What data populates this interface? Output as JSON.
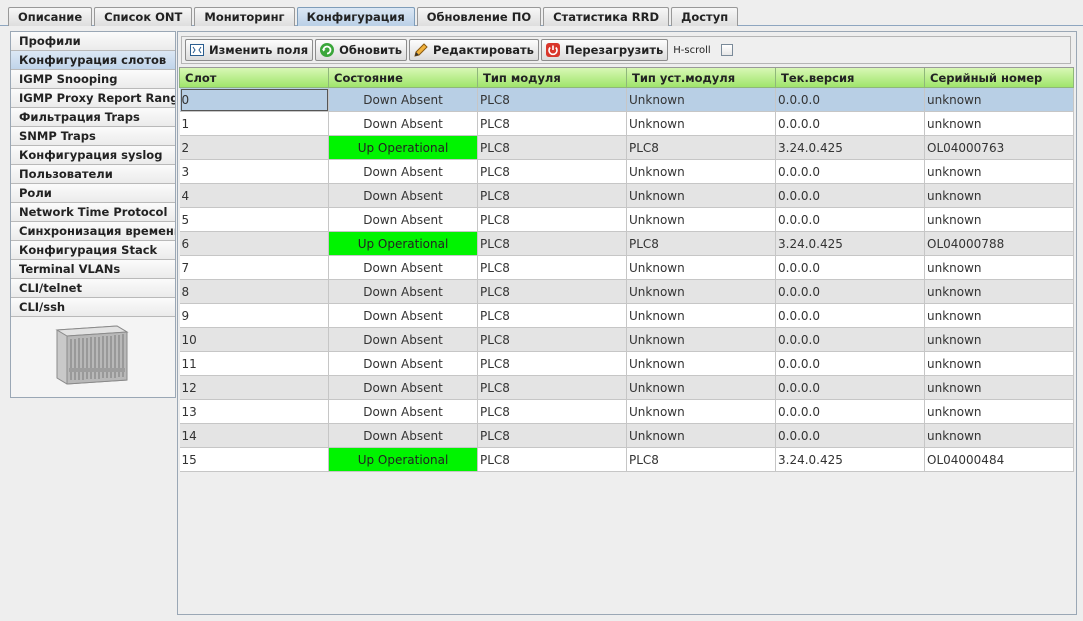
{
  "tabs": [
    {
      "label": "Описание"
    },
    {
      "label": "Список ONT"
    },
    {
      "label": "Мониторинг"
    },
    {
      "label": "Конфигурация",
      "active": true
    },
    {
      "label": "Обновление ПО"
    },
    {
      "label": "Статистика RRD"
    },
    {
      "label": "Доступ"
    }
  ],
  "sidebar": {
    "items": [
      {
        "label": "Профили"
      },
      {
        "label": "Конфигурация слотов",
        "active": true
      },
      {
        "label": "IGMP Snooping"
      },
      {
        "label": "IGMP Proxy Report Range"
      },
      {
        "label": "Фильтрация Traps"
      },
      {
        "label": "SNMP Traps"
      },
      {
        "label": "Конфигурация syslog"
      },
      {
        "label": "Пользователи"
      },
      {
        "label": "Роли"
      },
      {
        "label": "Network Time Protocol"
      },
      {
        "label": "Синхронизация времени"
      },
      {
        "label": "Конфигурация Stack"
      },
      {
        "label": "Terminal VLANs"
      },
      {
        "label": "CLI/telnet"
      },
      {
        "label": "CLI/ssh"
      }
    ],
    "device_icon": "chassis-device-icon"
  },
  "toolbar": {
    "edit_fields_label": "Изменить поля",
    "refresh_label": "Обновить",
    "edit_label": "Редактировать",
    "reboot_label": "Перезагрузить",
    "hscroll_label": "H-scroll",
    "hscroll_checked": false
  },
  "table": {
    "columns": [
      "Слот",
      "Состояние",
      "Тип модуля",
      "Тип уст.модуля",
      "Тек.версия",
      "Серийный номер"
    ],
    "rows": [
      [
        "0",
        "Down Absent",
        "PLC8",
        "Unknown",
        "0.0.0.0",
        "unknown"
      ],
      [
        "1",
        "Down Absent",
        "PLC8",
        "Unknown",
        "0.0.0.0",
        "unknown"
      ],
      [
        "2",
        "Up Operational",
        "PLC8",
        "PLC8",
        "3.24.0.425",
        "OL04000763"
      ],
      [
        "3",
        "Down Absent",
        "PLC8",
        "Unknown",
        "0.0.0.0",
        "unknown"
      ],
      [
        "4",
        "Down Absent",
        "PLC8",
        "Unknown",
        "0.0.0.0",
        "unknown"
      ],
      [
        "5",
        "Down Absent",
        "PLC8",
        "Unknown",
        "0.0.0.0",
        "unknown"
      ],
      [
        "6",
        "Up Operational",
        "PLC8",
        "PLC8",
        "3.24.0.425",
        "OL04000788"
      ],
      [
        "7",
        "Down Absent",
        "PLC8",
        "Unknown",
        "0.0.0.0",
        "unknown"
      ],
      [
        "8",
        "Down Absent",
        "PLC8",
        "Unknown",
        "0.0.0.0",
        "unknown"
      ],
      [
        "9",
        "Down Absent",
        "PLC8",
        "Unknown",
        "0.0.0.0",
        "unknown"
      ],
      [
        "10",
        "Down Absent",
        "PLC8",
        "Unknown",
        "0.0.0.0",
        "unknown"
      ],
      [
        "11",
        "Down Absent",
        "PLC8",
        "Unknown",
        "0.0.0.0",
        "unknown"
      ],
      [
        "12",
        "Down Absent",
        "PLC8",
        "Unknown",
        "0.0.0.0",
        "unknown"
      ],
      [
        "13",
        "Down Absent",
        "PLC8",
        "Unknown",
        "0.0.0.0",
        "unknown"
      ],
      [
        "14",
        "Down Absent",
        "PLC8",
        "Unknown",
        "0.0.0.0",
        "unknown"
      ],
      [
        "15",
        "Up Operational",
        "PLC8",
        "PLC8",
        "3.24.0.425",
        "OL04000484"
      ]
    ],
    "selected_row": 0
  },
  "colors": {
    "header_green": "#9fe56b",
    "state_up": "#00f400",
    "selection": "#b8cfe5"
  }
}
